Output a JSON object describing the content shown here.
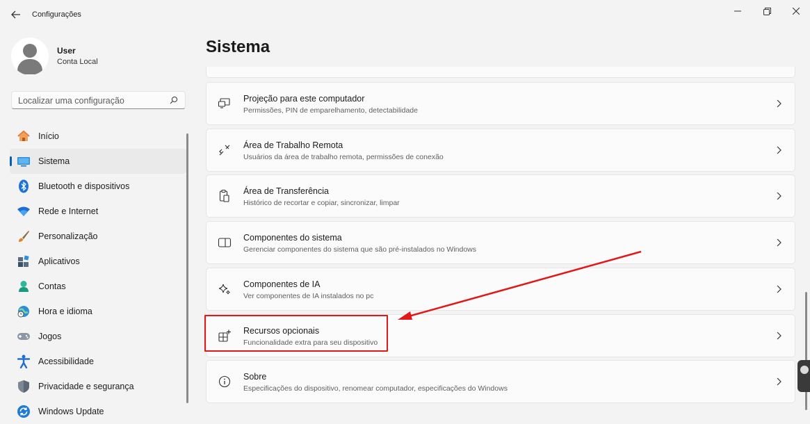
{
  "window": {
    "title": "Configurações",
    "back_icon": "back-arrow-icon",
    "controls": [
      "minimize-icon",
      "maximize-icon",
      "close-icon"
    ]
  },
  "user": {
    "name": "User",
    "account_type": "Conta Local"
  },
  "search": {
    "placeholder": "Localizar uma configuração",
    "icon": "search-icon"
  },
  "sidebar": {
    "items": [
      {
        "label": "Início",
        "icon": "home-icon",
        "active": false
      },
      {
        "label": "Sistema",
        "icon": "system-icon",
        "active": true
      },
      {
        "label": "Bluetooth e dispositivos",
        "icon": "bluetooth-icon",
        "active": false
      },
      {
        "label": "Rede e Internet",
        "icon": "wifi-icon",
        "active": false
      },
      {
        "label": "Personalização",
        "icon": "brush-icon",
        "active": false
      },
      {
        "label": "Aplicativos",
        "icon": "apps-icon",
        "active": false
      },
      {
        "label": "Contas",
        "icon": "accounts-icon",
        "active": false
      },
      {
        "label": "Hora e idioma",
        "icon": "globe-clock-icon",
        "active": false
      },
      {
        "label": "Jogos",
        "icon": "gamepad-icon",
        "active": false
      },
      {
        "label": "Acessibilidade",
        "icon": "accessibility-icon",
        "active": false
      },
      {
        "label": "Privacidade e segurança",
        "icon": "shield-icon",
        "active": false
      },
      {
        "label": "Windows Update",
        "icon": "update-icon",
        "active": false
      }
    ]
  },
  "main": {
    "title": "Sistema",
    "cards": [
      {
        "title": "Projeção para este computador",
        "subtitle": "Permissões, PIN de emparelhamento, detectabilidade",
        "icon": "projection-icon"
      },
      {
        "title": "Área de Trabalho Remota",
        "subtitle": "Usuários da área de trabalho remota, permissões de conexão",
        "icon": "remote-desktop-icon"
      },
      {
        "title": "Área de Transferência",
        "subtitle": "Histórico de recortar e copiar, sincronizar, limpar",
        "icon": "clipboard-icon"
      },
      {
        "title": "Componentes do sistema",
        "subtitle": "Gerenciar componentes do sistema que são pré-instalados no Windows",
        "icon": "system-components-icon"
      },
      {
        "title": "Componentes de IA",
        "subtitle": "Ver componentes de IA instalados no pc",
        "icon": "sparkle-icon"
      },
      {
        "title": "Recursos opcionais",
        "subtitle": "Funcionalidade extra para seu dispositivo",
        "icon": "optional-features-icon",
        "highlighted": true
      },
      {
        "title": "Sobre",
        "subtitle": "Especificações do dispositivo, renomear computador, especificações do Windows",
        "icon": "info-icon"
      }
    ]
  },
  "colors": {
    "accent": "#005fb8",
    "annotation": "#e01818",
    "background": "#f3f3f3",
    "card": "#fbfbfb"
  }
}
